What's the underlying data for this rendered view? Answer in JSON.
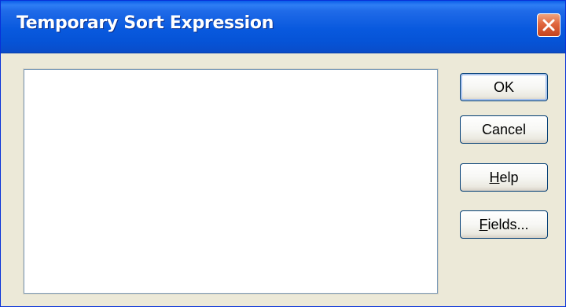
{
  "window": {
    "title": "Temporary Sort Expression",
    "close_icon": "close-icon"
  },
  "expression": {
    "value": ""
  },
  "buttons": {
    "ok": {
      "label": "OK"
    },
    "cancel": {
      "label": "Cancel"
    },
    "help": {
      "mnemonic": "H",
      "rest": "elp"
    },
    "fields": {
      "mnemonic": "F",
      "rest": "ields..."
    }
  },
  "colors": {
    "titlebar": "#0859de",
    "close_button": "#e0663e",
    "dialog_background": "#ece9d8"
  }
}
